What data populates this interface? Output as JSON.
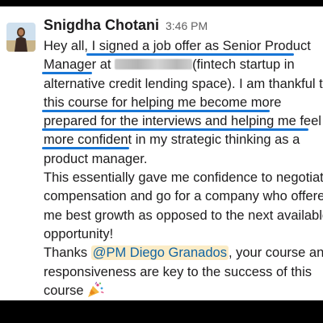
{
  "message": {
    "author": "Snigdha Chotani",
    "timestamp": "3:46 PM",
    "lines": [
      {
        "a": "Hey all, I signed a job offer as Senior Product"
      },
      {
        "a": "Manager at ",
        "b": "(fintech startup in"
      },
      {
        "a": "alternative credit lending space). I am thankful to"
      },
      {
        "a": "this course for helping me become more"
      },
      {
        "a": "prepared for the interviews and helping me feel"
      },
      {
        "a": "more confident in my strategic thinking as a"
      },
      {
        "a": "product manager."
      },
      {
        "a": "This essentially gave me confidence to negotiate"
      },
      {
        "a": "compensation and go for a company who offered"
      },
      {
        "a": "me best growth as opposed to the next available"
      },
      {
        "a": "opportunity!"
      },
      {
        "a": "Thanks ",
        "mention": "@PM Diego Granados",
        "b": ", your course and"
      },
      {
        "a": "responsiveness are key to the success of this"
      },
      {
        "a": "course"
      }
    ],
    "emoji": "party-popper-icon"
  },
  "colors": {
    "underline": "#1876d6",
    "mention_bg": "#fbecc6",
    "mention_text": "#1264a3",
    "text": "#1d1c1d",
    "timestamp": "#616061"
  }
}
